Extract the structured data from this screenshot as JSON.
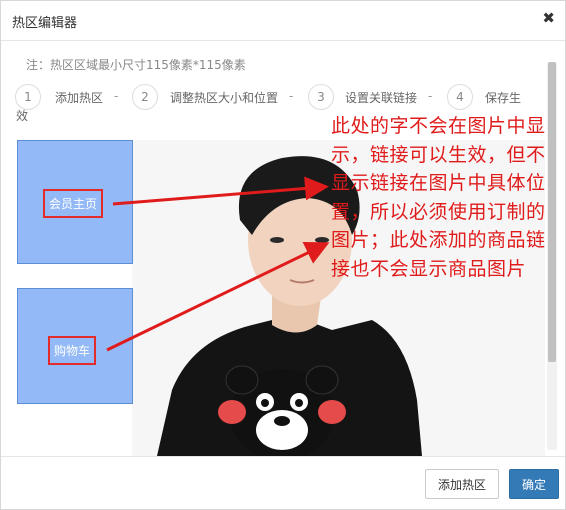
{
  "dialog": {
    "title": "热区编辑器",
    "close_glyph": "✖"
  },
  "note": "注：热区区域最小尺寸115像素*115像素",
  "steps": [
    {
      "num": "1",
      "label": "添加热区"
    },
    {
      "num": "2",
      "label": "调整热区大小和位置"
    },
    {
      "num": "3",
      "label": "设置关联链接"
    },
    {
      "num": "4",
      "label": "保存生",
      "label_wrap": "效"
    }
  ],
  "step_separator": "-",
  "hotzones": [
    {
      "label": "会员主页"
    },
    {
      "label": "购物车"
    }
  ],
  "annotation": "此处的字不会在图片中显示，链接可以生效，但不显示链接在图片中具体位置，所以必须使用订制的图片；此处添加的商品链接也不会显示商品图片",
  "footer": {
    "add_label": "添加热区",
    "ok_label": "确定"
  },
  "colors": {
    "hotzone_fill": "#93baf6",
    "annotation_red": "#e01b1b",
    "primary_button": "#337ab7"
  },
  "icons": [
    "close-icon"
  ]
}
